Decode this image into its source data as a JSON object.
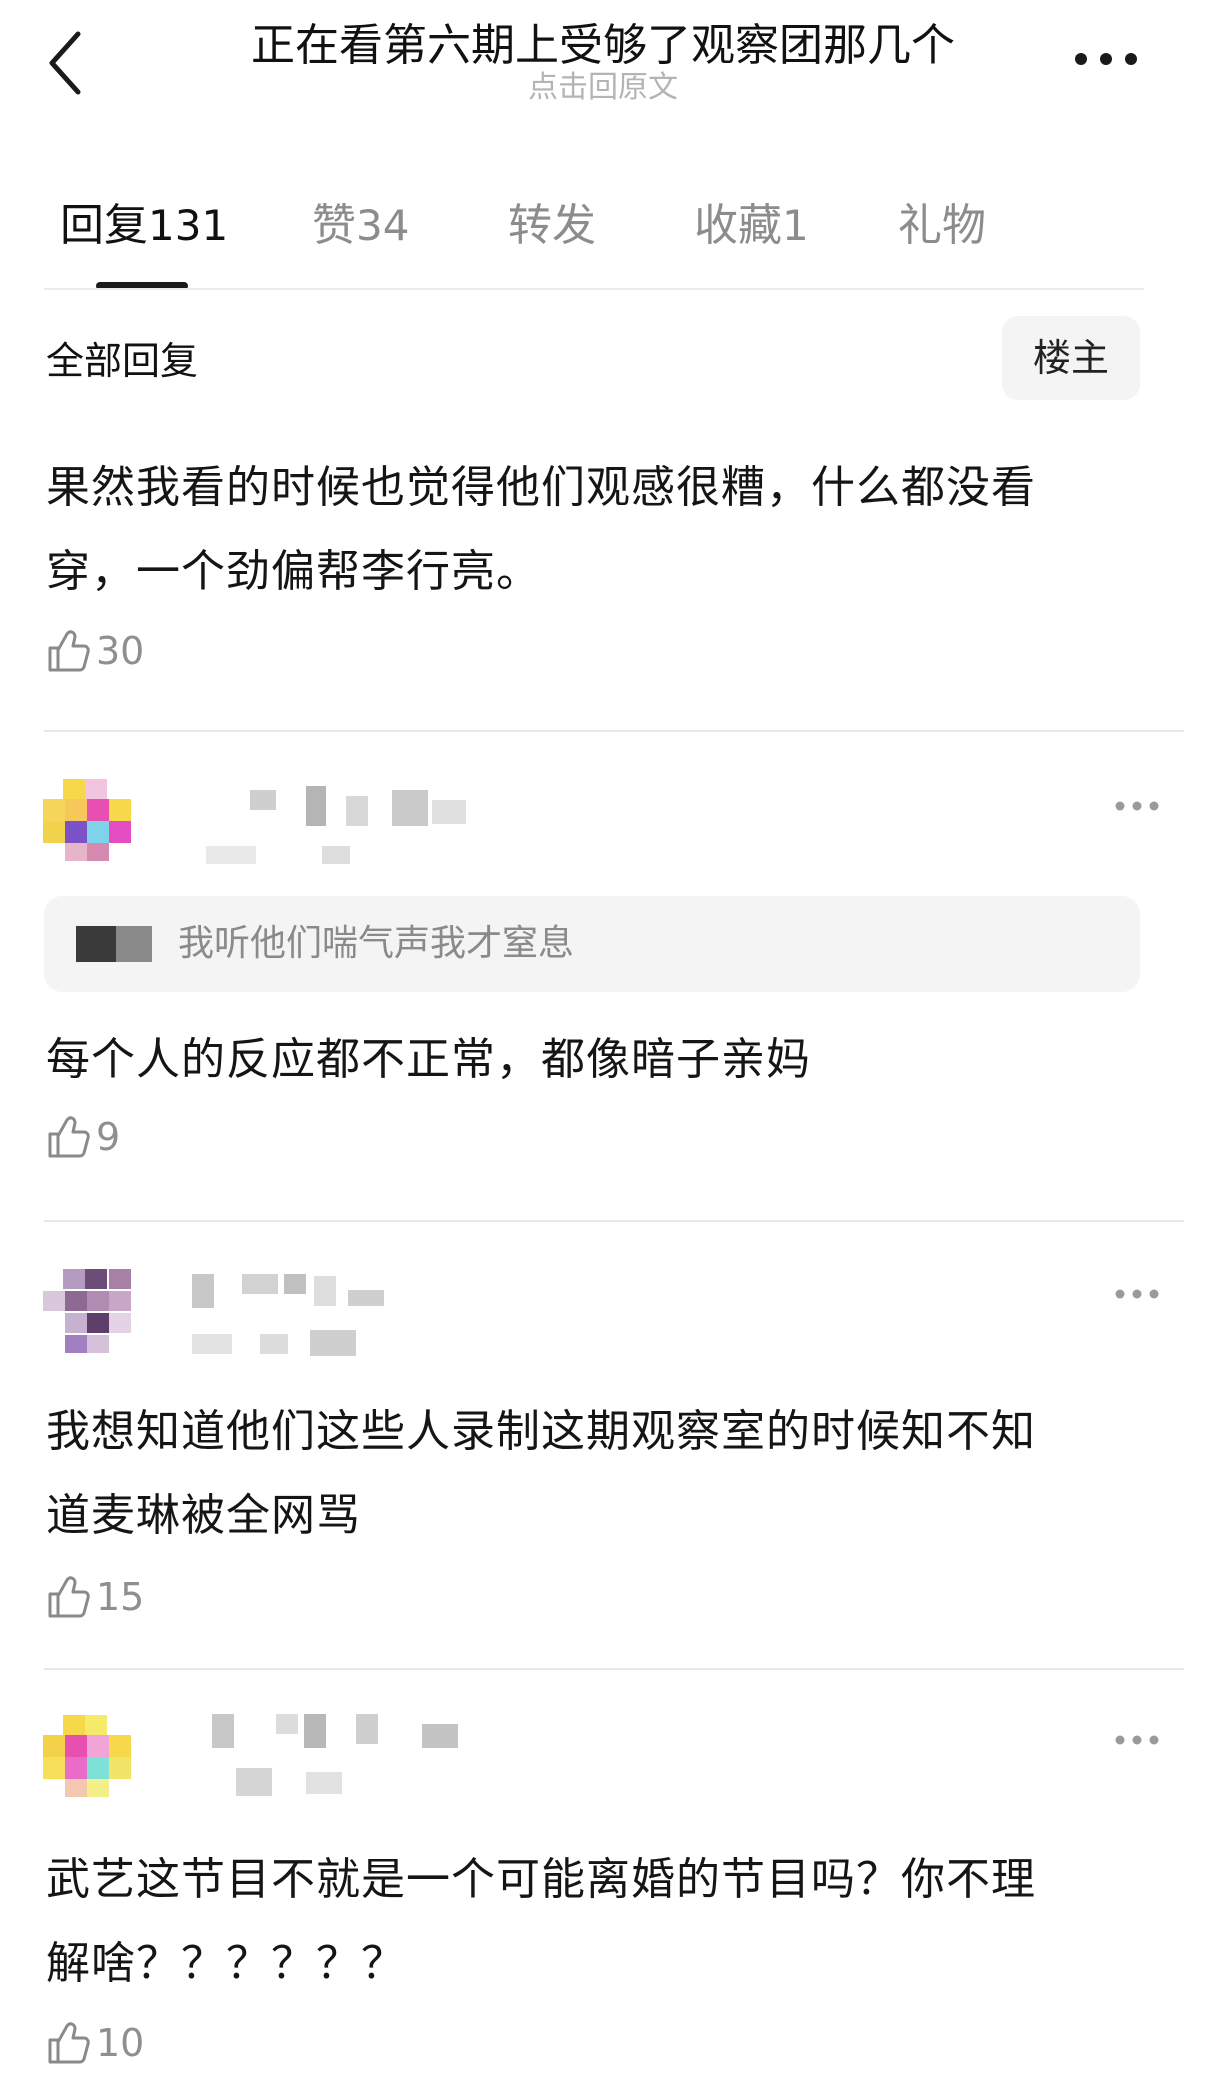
{
  "header": {
    "back_icon": "chevron-left-icon",
    "title": "正在看第六期上受够了观察团那几个",
    "subtitle": "点击回原文",
    "more_icon": "more-horizontal-icon"
  },
  "tabs": [
    {
      "label": "回复",
      "count": "131",
      "active": true
    },
    {
      "label": "赞",
      "count": "34",
      "active": false
    },
    {
      "label": "转发",
      "count": "",
      "active": false
    },
    {
      "label": "收藏",
      "count": "1",
      "active": false
    },
    {
      "label": "礼物",
      "count": "",
      "active": false
    }
  ],
  "section": {
    "label": "全部回复",
    "filter_button": "楼主"
  },
  "comments": [
    {
      "text_line1": "果然我看的时候也觉得他们观感很糟，什么都没看",
      "text_line2": "穿，一个劲偏帮李行亮。",
      "likes": "30"
    },
    {
      "quote": "我听他们喘气声我才窒息",
      "text_line1": "每个人的反应都不正常，都像暗子亲妈",
      "likes": "9"
    },
    {
      "text_line1": "我想知道他们这些人录制这期观察室的时候知不知",
      "text_line2": "道麦琳被全网骂",
      "likes": "15"
    },
    {
      "text_line1": "武艺这节目不就是一个可能离婚的节目吗？你不理",
      "text_line2": "解啥？？？？？？",
      "likes": "10"
    }
  ],
  "colors": {
    "text": "#151515",
    "muted": "#8f8f8f",
    "divider": "#e8e8e8",
    "chip_bg": "#f4f4f4"
  }
}
